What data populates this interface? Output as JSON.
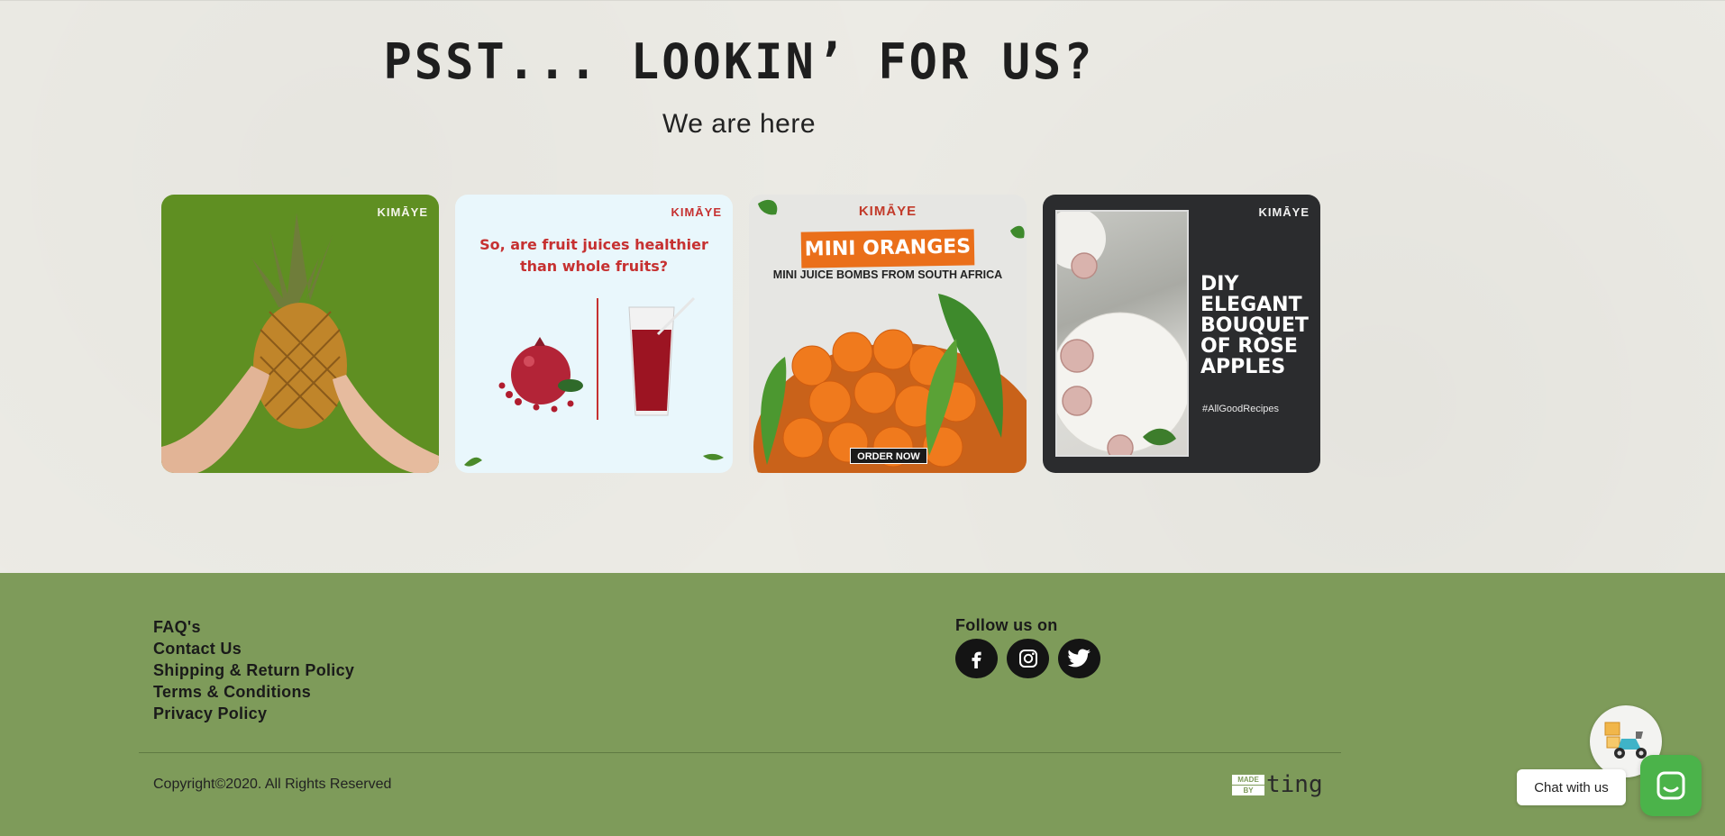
{
  "hero": {
    "headline": "PSST... LOOKIN’ FOR US?",
    "subhead": "We are here"
  },
  "tiles": [
    {
      "brand": "KIMĀYE",
      "icon": "pineapple-image"
    },
    {
      "brand": "KIMĀYE",
      "question": "So, are fruit juices healthier than whole fruits?",
      "icon": "pomegranate-juice-image"
    },
    {
      "brand": "KIMĀYE",
      "banner": "MINI ORANGES",
      "tagline": "MINI JUICE BOMBS FROM SOUTH AFRICA",
      "cta": "ORDER NOW",
      "icon": "oranges-image"
    },
    {
      "brand": "KIMĀYE",
      "title": "DIY ELEGANT BOUQUET OF ROSE APPLES",
      "hashtag": "#AllGoodRecipes",
      "icon": "rose-apple-image"
    }
  ],
  "footer": {
    "links": [
      "FAQ's",
      "Contact Us",
      "Shipping & Return Policy",
      "Terms & Conditions",
      "Privacy Policy"
    ],
    "follow_label": "Follow us on",
    "socials": [
      "facebook-icon",
      "instagram-icon",
      "twitter-icon"
    ],
    "copyright": "Copyright©2020. All Rights Reserved",
    "madeby_top": "MADE",
    "madeby_bottom": "BY",
    "madeby_word": "ting"
  },
  "chat": {
    "label": "Chat with us",
    "icon": "chat-icon",
    "mascot_icon": "delivery-scooter-icon"
  },
  "colors": {
    "page_bg": "#ecebe5",
    "footer_bg": "#7e9b5a",
    "chat_green": "#4bb34a",
    "brand_red": "#c63131"
  }
}
